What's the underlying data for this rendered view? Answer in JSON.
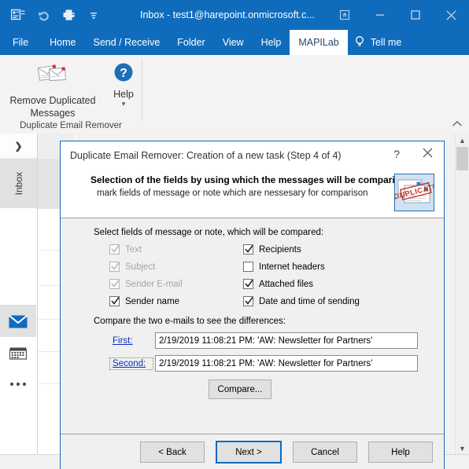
{
  "outlook": {
    "title": "Inbox - test1@harepoint.onmicrosoft.c...",
    "quick_access": [
      {
        "name": "outlook-icon",
        "glyph": "▤"
      },
      {
        "name": "undo-icon",
        "glyph": "↶"
      },
      {
        "name": "print-icon",
        "glyph": "⎙"
      },
      {
        "name": "customize-qat-icon",
        "glyph": "≡"
      }
    ],
    "window_controls": [
      {
        "name": "ribbon-display-options-icon",
        "glyph": "⬆"
      },
      {
        "name": "minimize-icon",
        "glyph": "—"
      },
      {
        "name": "maximize-icon",
        "glyph": "☐"
      },
      {
        "name": "close-icon",
        "glyph": "✕"
      }
    ],
    "tabs": [
      {
        "label": "File",
        "active": false
      },
      {
        "label": "Home",
        "active": false
      },
      {
        "label": "Send / Receive",
        "active": false
      },
      {
        "label": "Folder",
        "active": false
      },
      {
        "label": "View",
        "active": false
      },
      {
        "label": "Help",
        "active": false
      },
      {
        "label": "MAPILab",
        "active": true
      }
    ],
    "tell_me": "Tell me",
    "ribbon": {
      "group_label": "Duplicate Email Remover",
      "remove_duplicated_messages": "Remove Duplicated Messages",
      "help_label": "Help",
      "help_dropdown_glyph": "▾",
      "collapse_glyph": "⌃"
    },
    "nav": {
      "expand_glyph": "❯",
      "inbox_label": "Inbox",
      "items": [
        {
          "name": "mail-icon",
          "selected": true
        },
        {
          "name": "calendar-icon",
          "selected": false
        },
        {
          "name": "more-options-icon",
          "selected": false
        }
      ]
    },
    "scrollbar": {
      "up_glyph": "▲",
      "down_glyph": "▼"
    }
  },
  "dialog": {
    "title": "Duplicate Email Remover: Creation of a new task (Step 4 of 4)",
    "help_glyph": "?",
    "close_glyph": "✕",
    "header_title": "Selection of the fields by using which the messages will be comparing",
    "header_subtitle": "mark fields of message or note which are nessesary for comparison",
    "badge_stamp_text": "DUPLICATE",
    "section_label": "Select fields of message or note, which will be compared:",
    "checkboxes_left": [
      {
        "label": "Text",
        "checked": true,
        "disabled": true
      },
      {
        "label": "Subject",
        "checked": true,
        "disabled": true
      },
      {
        "label": "Sender E-mail",
        "checked": true,
        "disabled": true
      },
      {
        "label": "Sender name",
        "checked": true,
        "disabled": false
      }
    ],
    "checkboxes_right": [
      {
        "label": "Recipients",
        "checked": true,
        "disabled": false
      },
      {
        "label": "Internet headers",
        "checked": false,
        "disabled": false
      },
      {
        "label": "Attached files",
        "checked": true,
        "disabled": false
      },
      {
        "label": "Date and time of sending",
        "checked": true,
        "disabled": false
      }
    ],
    "compare_label": "Compare the two e-mails to see the differences:",
    "first_link": "First:",
    "first_value": "2/19/2019 11:08:21 PM: 'AW: Newsletter for Partners'",
    "second_link": "Second:",
    "second_value": "2/19/2019 11:08:21 PM: 'AW: Newsletter for Partners'",
    "compare_button": "Compare...",
    "buttons": [
      {
        "label": "< Back",
        "default": false
      },
      {
        "label": "Next >",
        "default": true
      },
      {
        "label": "Cancel",
        "default": false
      },
      {
        "label": "Help",
        "default": false
      }
    ]
  },
  "colors": {
    "accent": "#0f6cbd",
    "dialog_bg": "#f0f0f0",
    "link": "#0a2fc4",
    "stamp_red": "#c0392b"
  }
}
